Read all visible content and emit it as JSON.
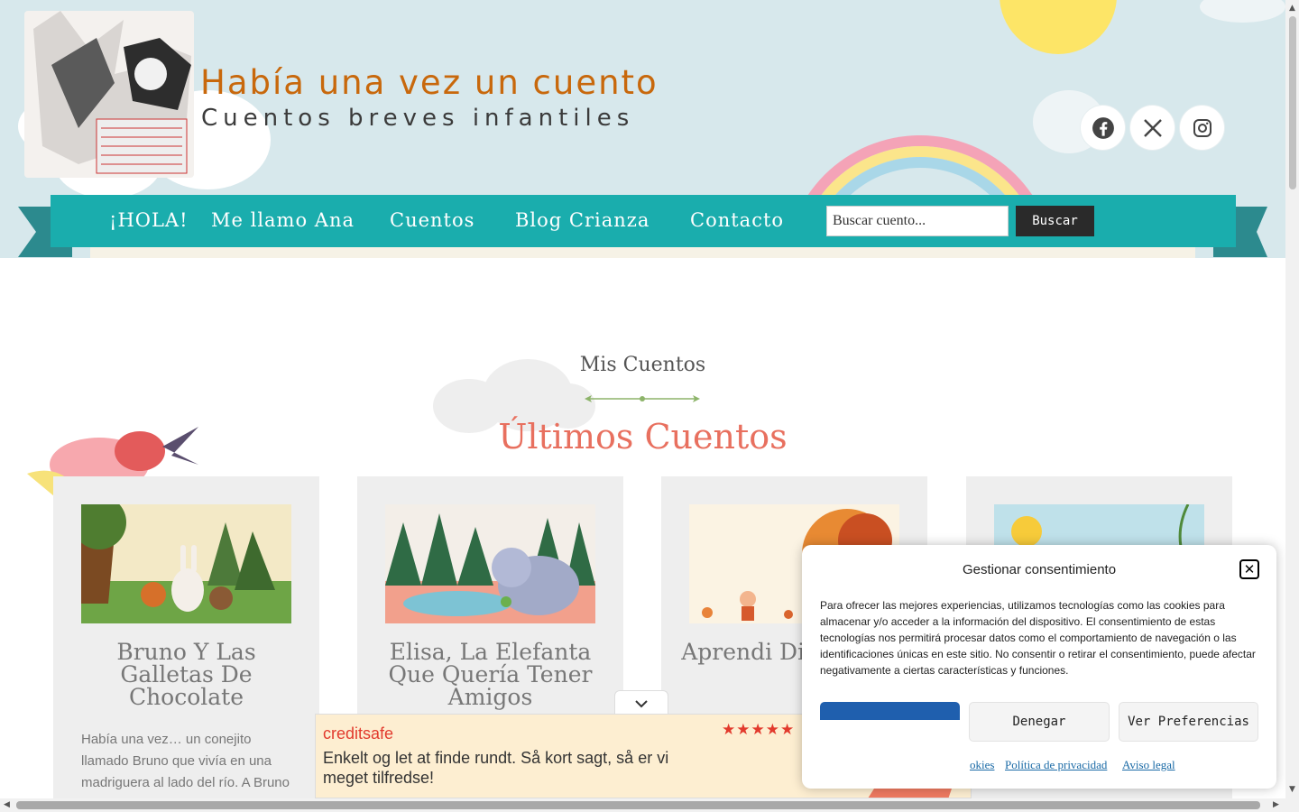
{
  "header": {
    "site_title": "Había una vez un cuento",
    "site_tagline": "Cuentos breves infantiles",
    "logo_icon": "logo-dog-drawing-icon",
    "social": [
      {
        "name": "facebook",
        "icon": "facebook-icon"
      },
      {
        "name": "x",
        "icon": "x-icon"
      },
      {
        "name": "instagram",
        "icon": "instagram-icon"
      }
    ]
  },
  "nav": {
    "items": [
      "¡HOLA!",
      "Me llamo Ana",
      "Cuentos",
      "Blog Crianza",
      "Contacto"
    ],
    "search_placeholder": "Buscar cuento...",
    "search_button": "Buscar"
  },
  "section": {
    "subtitle": "Mis Cuentos",
    "title": "Últimos Cuentos"
  },
  "cards": [
    {
      "title": "Bruno Y Las Galletas De Chocolate",
      "excerpt": "Había una vez… un conejito llamado Bruno que vivía en una madriguera al lado del río. A Bruno le"
    },
    {
      "title": "Elisa, La Elefanta Que Quería Tener Amigos",
      "excerpt": ""
    },
    {
      "title": "Aprendi Disfrut Oto",
      "excerpt": ""
    },
    {
      "title": "",
      "excerpt": ""
    }
  ],
  "ad": {
    "brand": "creditsafe",
    "stars": "★★★★★",
    "text": "Enkelt og let at finde rundt. Så kort sagt, så er vi meget tilfredse!"
  },
  "cookie": {
    "title": "Gestionar consentimiento",
    "text": "Para ofrecer las mejores experiencias, utilizamos tecnologías como las cookies para almacenar y/o acceder a la información del dispositivo. El consentimiento de estas tecnologías nos permitirá procesar datos como el comportamiento de navegación o las identificaciones únicas en este sitio. No consentir o retirar el consentimiento, puede afectar negativamente a ciertas características y funciones.",
    "deny_button": "Denegar",
    "prefs_button": "Ver Preferencias",
    "links": [
      "okies",
      "Política de privacidad",
      "Aviso legal"
    ]
  },
  "colors": {
    "accent_teal": "#1aadad",
    "title_orange": "#c8680c",
    "heading_coral": "#e8705f",
    "cookie_blue": "#1f5fae"
  }
}
